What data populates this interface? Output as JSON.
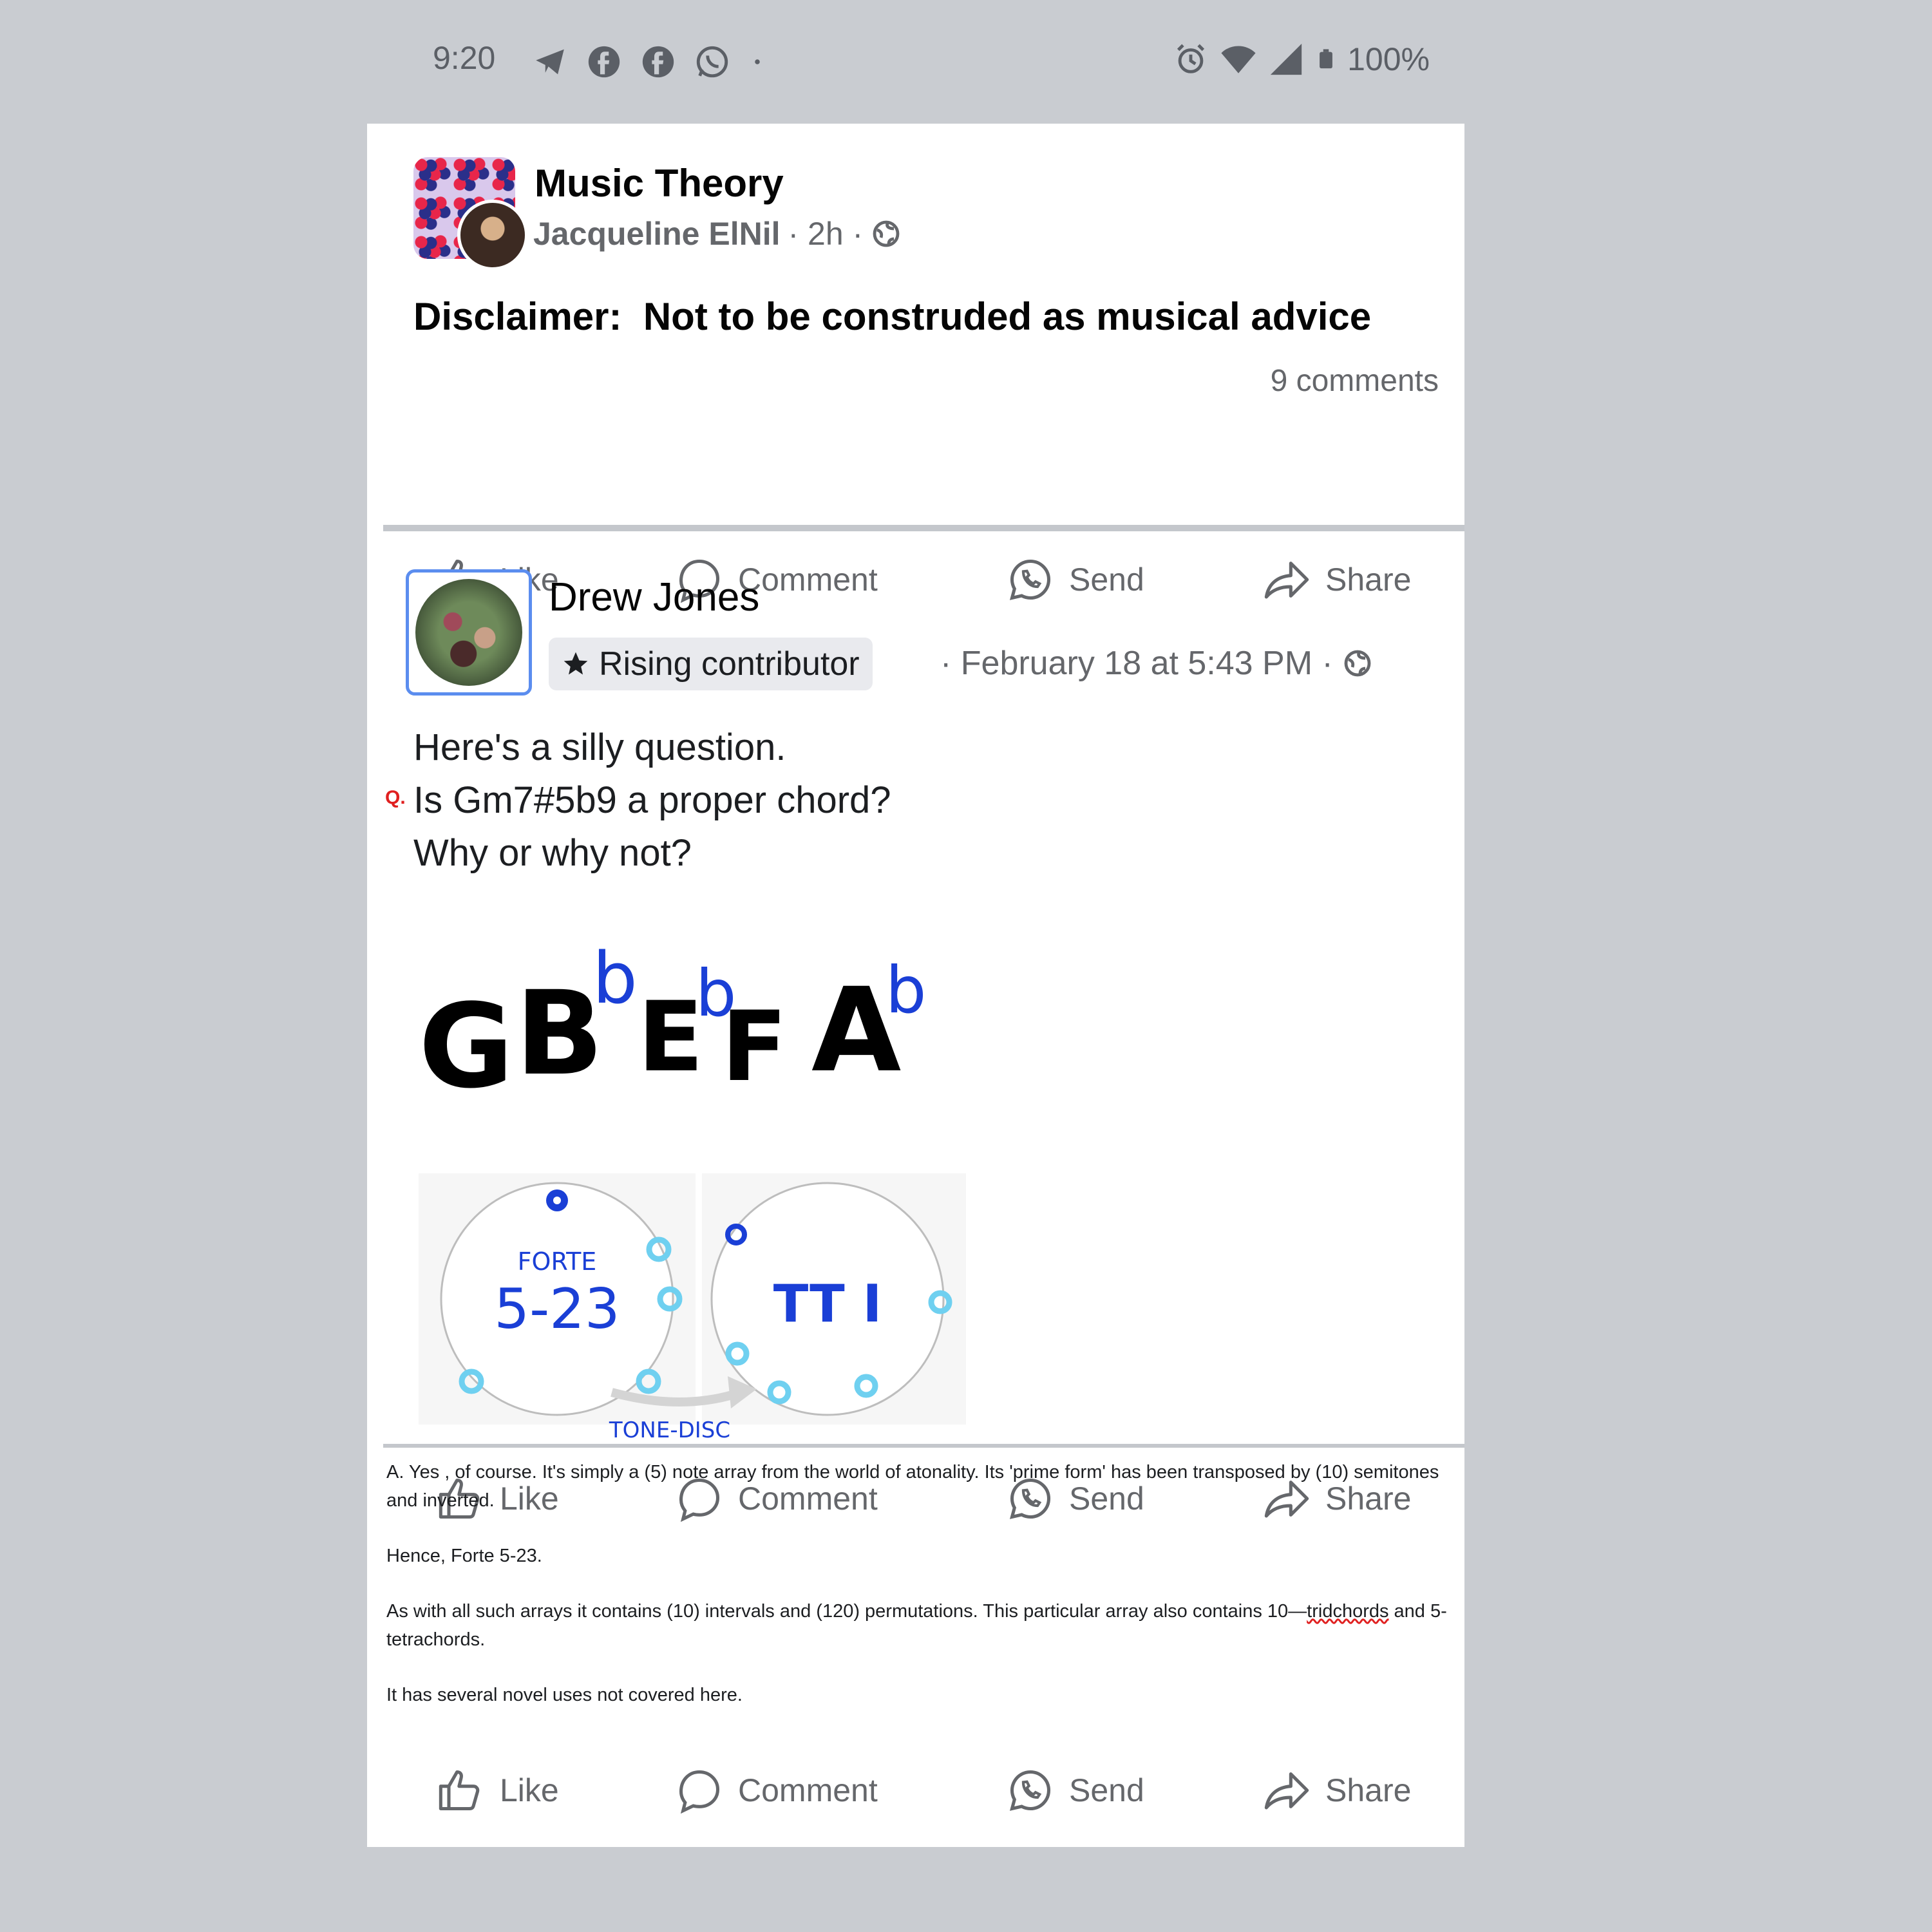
{
  "status_bar": {
    "time": "9:20",
    "app_icons": [
      "telegram-icon",
      "facebook-icon",
      "facebook-icon",
      "whatsapp-icon",
      "dot-icon"
    ],
    "system_icons": [
      "alarm-icon",
      "wifi-icon",
      "signal-icon",
      "battery-icon"
    ],
    "battery": "100%"
  },
  "post1": {
    "group_name": "Music Theory",
    "author": "Jacqueline ElNil",
    "time": "· 2h ·",
    "text": "Disclaimer:  Not to be construded as musical advice",
    "comments": "9 comments"
  },
  "actions": {
    "like": "Like",
    "comment": "Comment",
    "send": "Send",
    "share": "Share"
  },
  "post2": {
    "author": "Drew Jones",
    "badge": "Rising contributor",
    "time": "· February 18 at 5:43 PM ·",
    "q_marker": "Q.",
    "lines": [
      "Here's a silly question.",
      "Is Gm7#5b9 a proper chord?",
      "Why or why not?"
    ],
    "image": {
      "notes": [
        "G",
        "B",
        "E",
        "F",
        "A"
      ],
      "flat": "b",
      "disc1_top": "FORTE",
      "disc1_main": "5-23",
      "disc2_main": "TT I",
      "caption": "TONE-DISC"
    }
  },
  "answer": {
    "p1": "A.   Yes , of course.  It's simply a (5) note array from the world of atonality.  Its 'prime form' has been transposed by (10) semitones and inverted.",
    "p2": "Hence, Forte 5-23.",
    "p3a": "As with all such arrays it contains (10) intervals and (120) permutations.  This particular array also contains 10—",
    "p3b": "tridchords",
    "p3c": " and 5-tetrachords.",
    "p4": "It has several novel uses not covered here."
  },
  "colors": {
    "background": "#c9ccd1",
    "card": "#ffffff",
    "text_muted": "#65676b",
    "accent_blue": "#1a3fd6",
    "light_blue": "#6fd0f0"
  }
}
